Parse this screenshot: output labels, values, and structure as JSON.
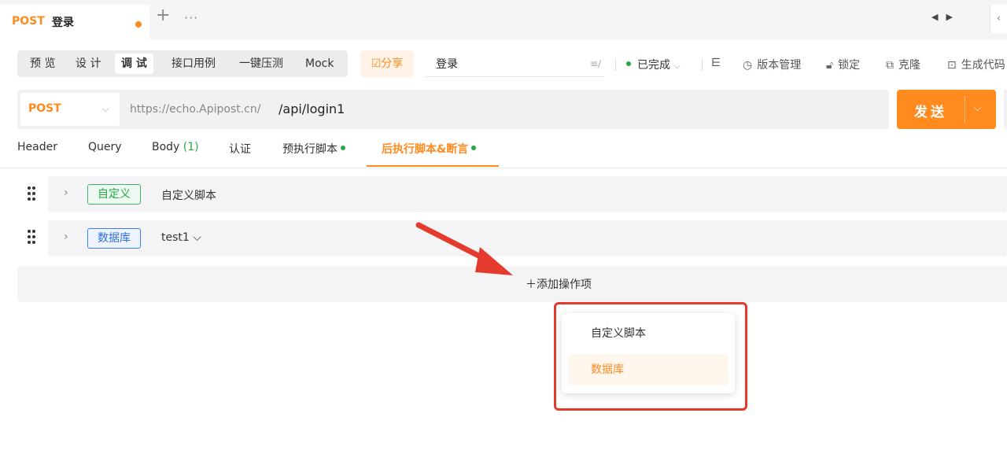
{
  "tab": {
    "method": "POST",
    "title": "登录"
  },
  "toolbar": {
    "modes": [
      "预 览",
      "设 计",
      "调 试",
      "接口用例",
      "一键压测",
      "Mock"
    ],
    "active_mode": "调 试",
    "share_label": "☑分享",
    "name_value": "登录",
    "status": "已完成",
    "tools": [
      "版本管理",
      "锁定",
      "克隆",
      "生成代码"
    ]
  },
  "request": {
    "method": "POST",
    "base_url": "https://echo.Apipost.cn/",
    "path": "/api/login1",
    "send_label": "发送"
  },
  "subtabs": {
    "header": "Header",
    "query": "Query",
    "body": "Body",
    "body_count": "(1)",
    "auth": "认证",
    "pre_script": "预执行脚本",
    "post_script": "后执行脚本&断言"
  },
  "operations": [
    {
      "tag": "自定义",
      "name": "自定义脚本"
    },
    {
      "tag": "数据库",
      "name": "test1 ⌵"
    }
  ],
  "add_operation": "＋添加操作项",
  "menu": {
    "items": [
      "自定义脚本",
      "数据库"
    ],
    "selected": "数据库"
  },
  "colors": {
    "accent": "#ff8a1e",
    "success": "#27a644",
    "highlight": "#e53a2e",
    "db_blue": "#2e6fe0"
  }
}
